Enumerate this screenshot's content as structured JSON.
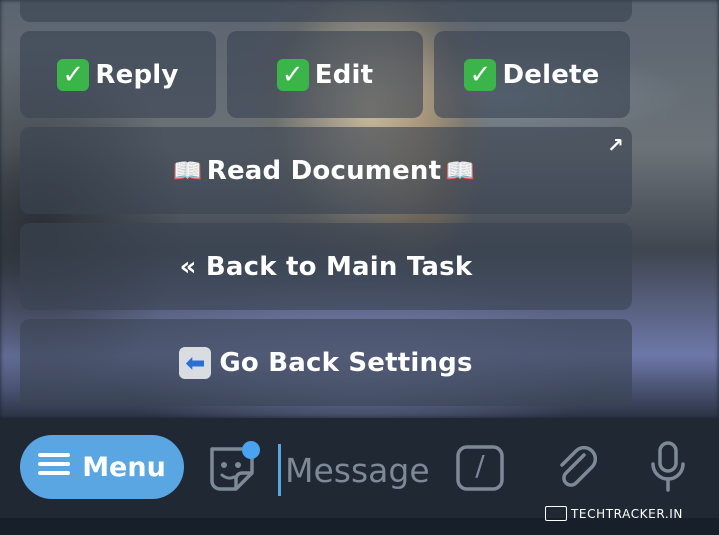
{
  "keyboard": {
    "reply_label": "Reply",
    "edit_label": "Edit",
    "delete_label": "Delete",
    "check_glyph": "✓",
    "read_document_label": "Read Document",
    "book_glyph": "📖",
    "open_link_glyph": "↗",
    "back_main_label": "« Back to Main Task",
    "go_back_glyph": "⬅",
    "go_back_label": "Go Back Settings"
  },
  "input_bar": {
    "menu_label": "Menu",
    "message_placeholder": "Message",
    "command_glyph": "/"
  },
  "watermark": {
    "text": "TECHTRACKER.IN"
  },
  "colors": {
    "menu_button": "#5aa6e2",
    "check_green": "#3bb54a",
    "notification_dot": "#4aa3f0",
    "input_bar": "#1f2833"
  },
  "icons": [
    "menu-icon",
    "sticker-icon",
    "command-icon",
    "attach-icon",
    "microphone-icon",
    "open-link-icon"
  ]
}
